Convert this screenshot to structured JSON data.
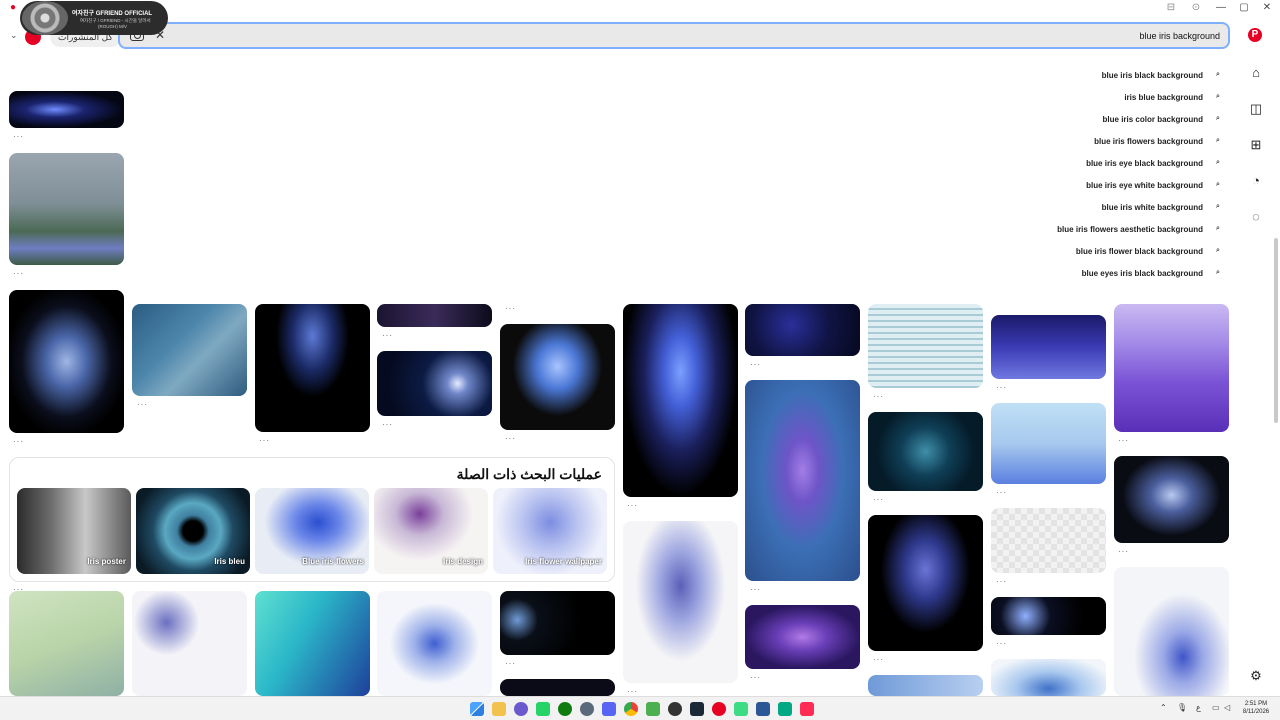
{
  "window": {
    "controls": [
      "—",
      "▢",
      "✕"
    ],
    "pin_controls": [
      "⊟",
      "⊙"
    ]
  },
  "media": {
    "title": "여자친구 GFRIEND OFFICIAL",
    "line1": "여자친구 / GFRIEND - 시간을 달려서",
    "line2": "(ROUGH) M/V"
  },
  "header": {
    "posts_button": "كل المنشورات",
    "back_icon": "back-arrow-icon",
    "forward_icon": "forward-arrow-icon"
  },
  "search": {
    "value": "blue iris background",
    "clear_icon": "✕"
  },
  "suggestions": [
    "blue iris black background",
    "iris blue background",
    "blue iris color background",
    "blue iris flowers background",
    "blue iris eye black background",
    "blue iris eye white background",
    "blue iris white background",
    "blue iris flowers aesthetic background",
    "blue iris flower black background",
    "blue eyes iris black background"
  ],
  "more": "···",
  "related": {
    "title": "عمليات البحث ذات الصلة",
    "items": [
      {
        "label": "Iris flower wallpaper"
      },
      {
        "label": "Iris design"
      },
      {
        "label": "Blue iris flowers"
      },
      {
        "label": "Iris bleu"
      },
      {
        "label": "Iris poster"
      }
    ]
  },
  "sidebar": [
    "home-icon",
    "layout-icon",
    "create-icon",
    "bell-icon",
    "messages-icon",
    "settings-icon"
  ],
  "pinterest_logo": "P",
  "clock": {
    "time": "2:51 PM",
    "date": "8/11/2026"
  },
  "tray": {
    "lang": "ع"
  },
  "colors": {
    "brand": "#e60023",
    "focus": "#7fb0ff"
  }
}
